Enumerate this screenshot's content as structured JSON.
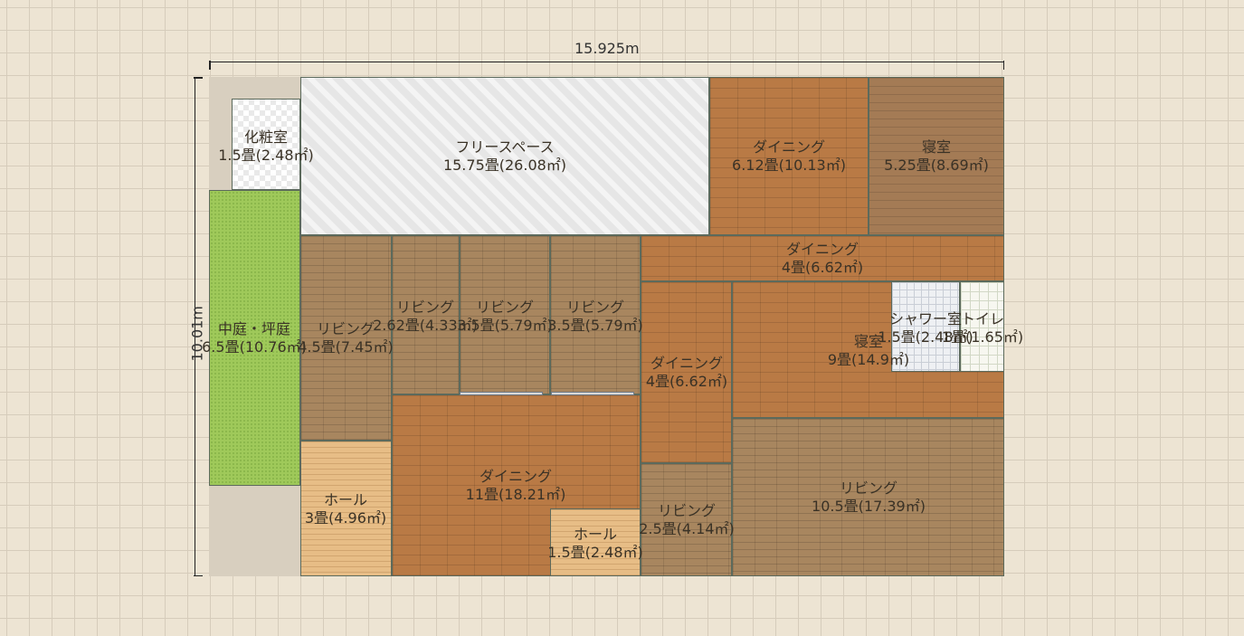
{
  "dimensions": {
    "width": "15.925m",
    "height": "10.01m"
  },
  "rooms": [
    {
      "name": "化粧室",
      "area": "1.5畳(2.48㎡)"
    },
    {
      "name": "フリースペース",
      "area": "15.75畳(26.08㎡)"
    },
    {
      "name": "ダイニング",
      "area": "6.12畳(10.13㎡)"
    },
    {
      "name": "寝室",
      "area": "5.25畳(8.69㎡)"
    },
    {
      "name": "中庭・坪庭",
      "area": "6.5畳(10.76㎡)"
    },
    {
      "name": "リビング",
      "area": "4.5畳(7.45㎡)"
    },
    {
      "name": "リビング",
      "area": "2.62畳(4.33㎡)"
    },
    {
      "name": "リビング",
      "area": "3.5畳(5.79㎡)"
    },
    {
      "name": "リビング",
      "area": "3.5畳(5.79㎡)"
    },
    {
      "name": "ダイニング",
      "area": "4畳(6.62㎡)"
    },
    {
      "name": "ダイニング",
      "area": "4畳(6.62㎡)"
    },
    {
      "name": "寝室",
      "area": "9畳(14.9㎡)"
    },
    {
      "name": "シャワー室",
      "area": "1.5畳(2.48㎡)"
    },
    {
      "name": "トイレ",
      "area": "1畳(1.65㎡)"
    },
    {
      "name": "ダイニング",
      "area": "11畳(18.21㎡)"
    },
    {
      "name": "ホール",
      "area": "3畳(4.96㎡)"
    },
    {
      "name": "ホール",
      "area": "1.5畳(2.48㎡)"
    },
    {
      "name": "リビング",
      "area": "2.5畳(4.14㎡)"
    },
    {
      "name": "リビング",
      "area": "10.5畳(17.39㎡)"
    }
  ]
}
